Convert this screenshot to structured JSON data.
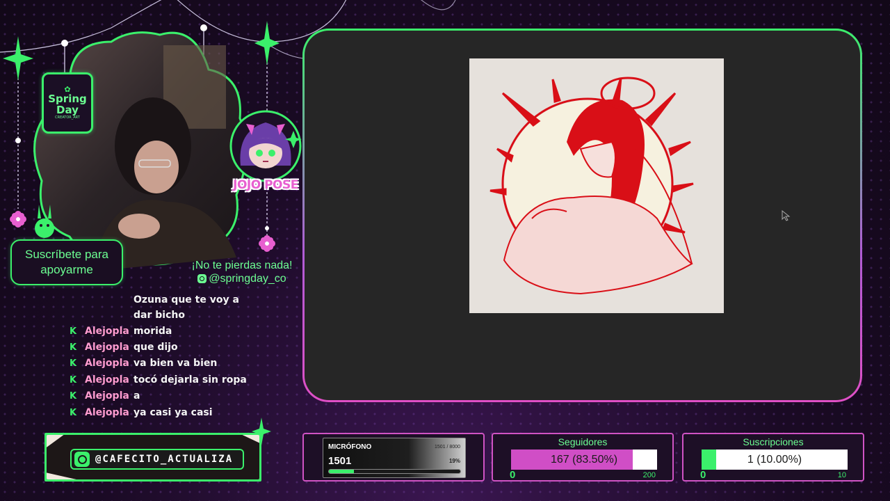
{
  "overlay": {
    "brand_badge": {
      "line1": "Spring",
      "line2": "Day",
      "sub": "CREATOR_ART"
    },
    "emote_label": "JOJO POSE",
    "subscribe_cta": {
      "line1": "Suscríbete para",
      "line2": "apoyarme"
    },
    "instagram_note": {
      "tagline": "¡No te pierdas nada!",
      "handle": "@springday_co"
    },
    "tip_handle": "@CAFECITO_ACTUALIZA"
  },
  "chat": {
    "continuation": [
      "Ozuna que te voy a",
      "dar bicho"
    ],
    "messages": [
      {
        "user": "Alejopla",
        "text": "morida"
      },
      {
        "user": "Alejopla",
        "text": "que dijo"
      },
      {
        "user": "Alejopla",
        "text": "va bien va bien"
      },
      {
        "user": "Alejopla",
        "text": "tocó dejarla sin ropa"
      },
      {
        "user": "Alejopla",
        "text": "a"
      },
      {
        "user": "Alejopla",
        "text": "ya casi ya casi"
      }
    ],
    "platform_icon": "kick-icon"
  },
  "widgets": {
    "microphone": {
      "title": "MICRÓFONO",
      "value": "1501",
      "range": "1501 / 8000",
      "percent_label": "19%",
      "fill_fraction": 0.19
    },
    "followers": {
      "title": "Seguidores",
      "progress_text": "167 (83.50%)",
      "min": "0",
      "max": "200",
      "fill_fraction": 0.835,
      "fill_color": "#d04ec6"
    },
    "subscriptions": {
      "title": "Suscripciones",
      "progress_text": "1 (10.00%)",
      "min": "0",
      "max": "10",
      "fill_fraction": 0.1,
      "fill_color": "#3bf06b"
    }
  },
  "colors": {
    "accent_green": "#3bf06b",
    "accent_pink": "#d04ec6",
    "background": "#14091d",
    "canvas": "#262626"
  }
}
